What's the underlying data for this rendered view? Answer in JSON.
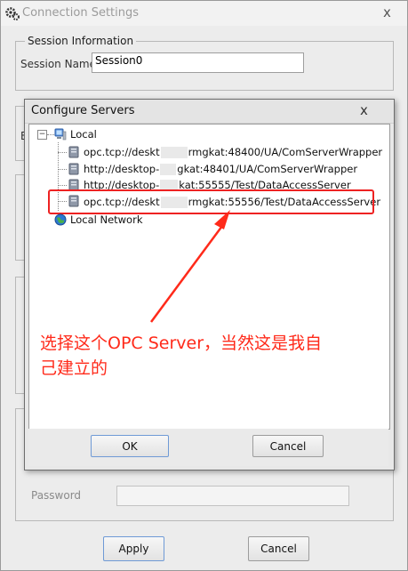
{
  "outer": {
    "title": "Connection Settings",
    "close": "x",
    "session_group": "Session Information",
    "session_name_label": "Session Name",
    "session_name_value": "Session0",
    "partial_label": "E",
    "password_label": "Password",
    "apply_label": "Apply",
    "cancel_label": "Cancel"
  },
  "modal": {
    "title": "Configure Servers",
    "close": "x",
    "expander": "−",
    "nodes": {
      "local": "Local",
      "s1_pre": "opc.tcp://deskt",
      "s1_post": "rmgkat:48400/UA/ComServerWrapper",
      "s2_pre": "http://desktop-",
      "s2_post": "gkat:48401/UA/ComServerWrapper",
      "s3_pre": "http://desktop-",
      "s3_post": "kat:55555/Test/DataAccessServer",
      "s4_pre": "opc.tcp://deskt",
      "s4_post": "rmgkat:55556/Test/DataAccessServer",
      "network": "Local Network"
    },
    "ok_label": "OK",
    "cancel_label": "Cancel"
  },
  "annotation": {
    "line1": "选择这个OPC Server，当然这是我自",
    "line2": "己建立的"
  },
  "colors": {
    "annotation": "#ff2a1a",
    "highlight": "#e22"
  }
}
